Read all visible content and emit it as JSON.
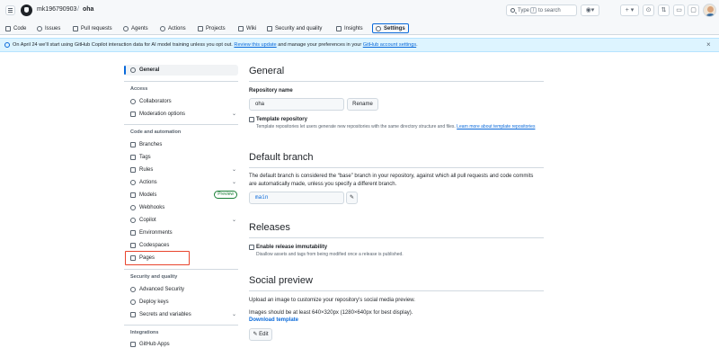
{
  "header": {
    "owner": "mk196790903",
    "separator": "/",
    "repo": "oha",
    "search_text": "Type",
    "search_key": "/",
    "search_text2": "to search",
    "plus_label": "+ ▾"
  },
  "nav": {
    "tabs": [
      {
        "label": "Code",
        "icon": "code-icon"
      },
      {
        "label": "Issues",
        "icon": "issue-icon"
      },
      {
        "label": "Pull requests",
        "icon": "pull-request-icon"
      },
      {
        "label": "Agents",
        "icon": "agent-icon"
      },
      {
        "label": "Actions",
        "icon": "play-icon"
      },
      {
        "label": "Projects",
        "icon": "table-icon"
      },
      {
        "label": "Wiki",
        "icon": "book-icon"
      },
      {
        "label": "Security and quality",
        "icon": "shield-icon"
      },
      {
        "label": "Insights",
        "icon": "graph-icon"
      },
      {
        "label": "Settings",
        "icon": "gear-icon"
      }
    ],
    "selected": "Settings"
  },
  "banner": {
    "text_before": "On April 24 we'll start using GitHub Copilot interaction data for AI model training unless you opt out.",
    "link1": "Review this update",
    "text_middle": "and manage your preferences in your",
    "link2": "GitHub account settings",
    "text_after": ".",
    "close": "×"
  },
  "sidebar": {
    "general": "General",
    "access_heading": "Access",
    "collaborators": "Collaborators",
    "moderation": "Moderation options",
    "code_heading": "Code and automation",
    "branches": "Branches",
    "tags": "Tags",
    "rules": "Rules",
    "actions": "Actions",
    "models": "Models",
    "models_badge": "Preview",
    "webhooks": "Webhooks",
    "copilot": "Copilot",
    "environments": "Environments",
    "codespaces": "Codespaces",
    "pages": "Pages",
    "security_heading": "Security and quality",
    "advanced_security": "Advanced Security",
    "deploy_keys": "Deploy keys",
    "secrets": "Secrets and variables",
    "integrations_heading": "Integrations",
    "github_apps": "GitHub Apps",
    "chevron": "⌄"
  },
  "main": {
    "general_title": "General",
    "repo_name_label": "Repository name",
    "repo_name_value": "oha",
    "rename_button": "Rename",
    "template_label": "Template repository",
    "template_note": "Template repositories let users generate new repositories with the same directory structure and files.",
    "template_link": "Learn more about template repositories",
    "default_branch_title": "Default branch",
    "default_branch_desc": "The default branch is considered the “base” branch in your repository, against which all pull requests and code commits are automatically made, unless you specify a different branch.",
    "default_branch_value": "main",
    "releases_title": "Releases",
    "immutability_label": "Enable release immutability",
    "immutability_note": "Disallow assets and tags from being modified once a release is published.",
    "social_title": "Social preview",
    "social_desc": "Upload an image to customize your repository's social media preview.",
    "social_size": "Images should be at least 640×320px (1280×640px for best display).",
    "download_template": "Download template",
    "edit_button": "Edit"
  }
}
